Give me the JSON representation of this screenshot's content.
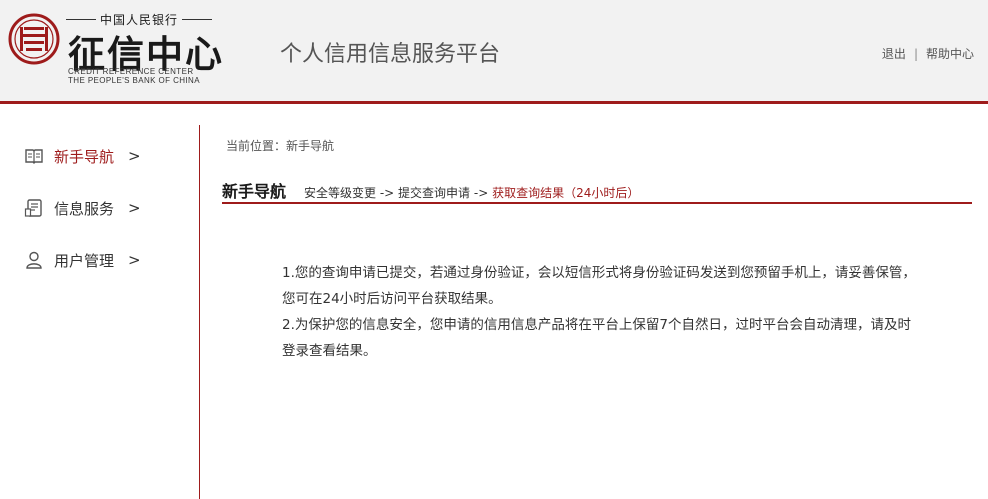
{
  "header": {
    "org_top": "中国人民银行",
    "org_main": "征信中心",
    "org_en_line1": "CREDIT REFERENCE CENTER",
    "org_en_line2": "THE PEOPLE'S BANK OF CHINA",
    "platform_title": "个人信用信息服务平台",
    "links": {
      "logout": "退出",
      "separator": "|",
      "help": "帮助中心"
    },
    "accent_color": "#9e1b1b"
  },
  "sidebar": {
    "items": [
      {
        "label": "新手导航",
        "arrow": ">",
        "icon": "book-icon",
        "active": true
      },
      {
        "label": "信息服务",
        "arrow": ">",
        "icon": "document-icon",
        "active": false
      },
      {
        "label": "用户管理",
        "arrow": ">",
        "icon": "user-icon",
        "active": false
      }
    ]
  },
  "breadcrumb": {
    "prefix": "当前位置：",
    "current": "新手导航"
  },
  "section": {
    "title": "新手导航",
    "steps": [
      "安全等级变更",
      "提交查询申请",
      "获取查询结果（24小时后）"
    ],
    "step_separator": " -> ",
    "current_step_index": 2
  },
  "content": {
    "paragraphs": [
      "1.您的查询申请已提交，若通过身份验证，会以短信形式将身份验证码发送到您预留手机上，请妥善保管，您可在24小时后访问平台获取结果。",
      "2.为保护您的信息安全，您申请的信用信息产品将在平台上保留7个自然日，过时平台会自动清理，请及时登录查看结果。"
    ]
  }
}
